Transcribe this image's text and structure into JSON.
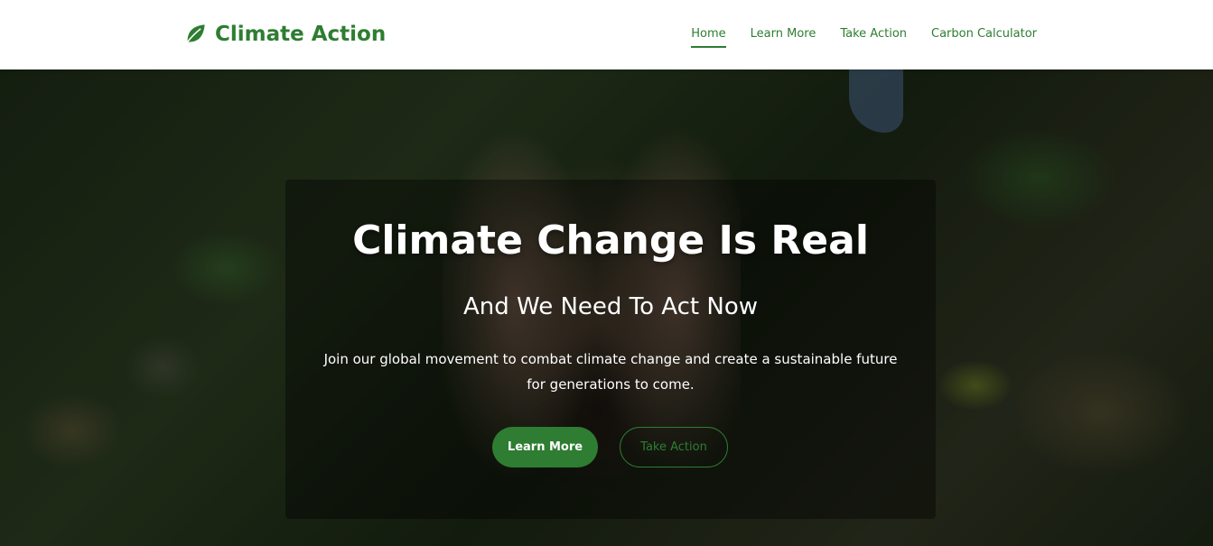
{
  "header": {
    "brand_title": "Climate Action",
    "brand_icon": "leaf-icon",
    "nav": [
      {
        "label": "Home",
        "active": true
      },
      {
        "label": "Learn More",
        "active": false
      },
      {
        "label": "Take Action",
        "active": false
      },
      {
        "label": "Carbon Calculator",
        "active": false
      }
    ]
  },
  "hero": {
    "title": "Climate Change Is Real",
    "subtitle": "And We Need To Act Now",
    "text": "Join our global movement to combat climate change and create a sustainable future for generations to come.",
    "primary_button": "Learn More",
    "secondary_button": "Take Action"
  },
  "colors": {
    "brand_green": "#2e7d32",
    "header_bg": "#ffffff",
    "hero_text": "#ffffff"
  }
}
